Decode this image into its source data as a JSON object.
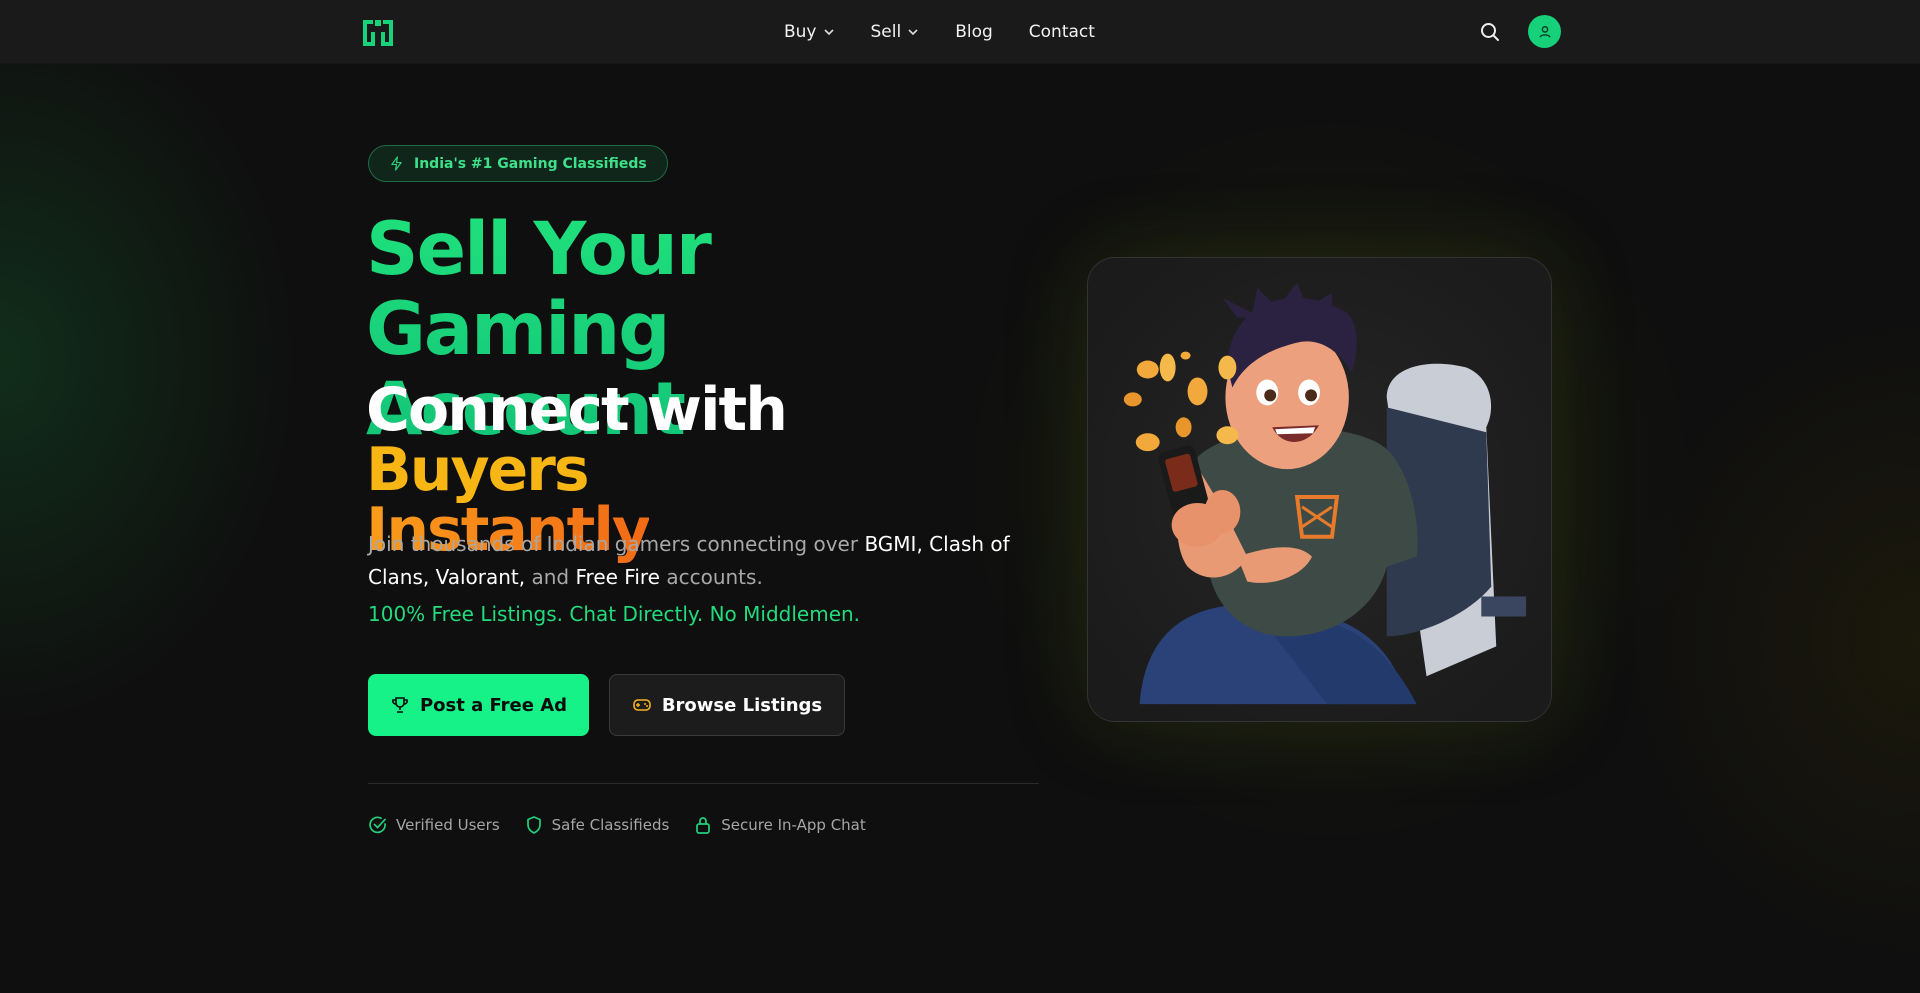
{
  "nav": {
    "items": [
      {
        "label": "Buy",
        "dropdown": true
      },
      {
        "label": "Sell",
        "dropdown": true
      },
      {
        "label": "Blog",
        "dropdown": false
      },
      {
        "label": "Contact",
        "dropdown": false
      }
    ],
    "icons": {
      "logo": "gamepad-logo-icon",
      "search": "search-icon",
      "user": "user-icon"
    }
  },
  "hero": {
    "badge": "India's #1 Gaming Classifieds",
    "heading_line1": "Sell Your Gaming",
    "heading_line2": "Account",
    "subheading_white": "Connect with",
    "subheading_buyers": "Buyers",
    "subheading_instantly": "Instantly",
    "desc_prefix": "Join thousands of Indian gamers connecting over",
    "desc_games1": "BGMI, Clash of Clans, Valorant,",
    "desc_and": "and",
    "desc_games2": "Free Fire",
    "desc_suffix": "accounts.",
    "tagline": "100% Free Listings. Chat Directly. No Middlemen.",
    "primary_button": "Post a Free Ad",
    "secondary_button": "Browse Listings",
    "trust": [
      {
        "label": "Verified Users",
        "icon": "check-circle-icon"
      },
      {
        "label": "Safe Classifieds",
        "icon": "shield-icon"
      },
      {
        "label": "Secure In-App Chat",
        "icon": "lock-icon"
      }
    ]
  },
  "colors": {
    "accent_green": "#16f287",
    "heading_green": "#1fe07c",
    "buyers_yellow": "#f7b614",
    "instantly_orange": "#f26a16",
    "background": "#0f0f0f",
    "nav_bg": "#1a1a1a"
  }
}
